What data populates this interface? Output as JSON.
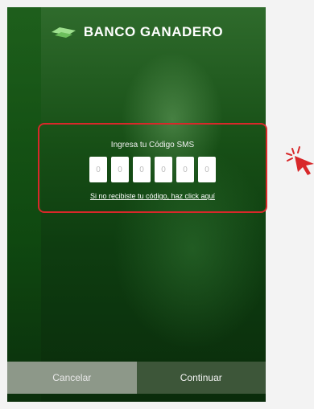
{
  "brand": {
    "name": "BANCO GANADERO"
  },
  "sms": {
    "title": "Ingresa tu Código SMS",
    "digits": [
      "0",
      "0",
      "0",
      "0",
      "0",
      "0"
    ],
    "resend_link": "Si no recibiste tu código, haz click aquí"
  },
  "footer": {
    "cancel_label": "Cancelar",
    "continue_label": "Continuar"
  },
  "colors": {
    "highlight_red": "#d8282a",
    "brand_green": "#1f5a1d",
    "cancel_bg": "#8d9889",
    "continue_bg": "#3d5639"
  },
  "icons": [
    "brand-logo-icon",
    "click-pointer-icon"
  ]
}
